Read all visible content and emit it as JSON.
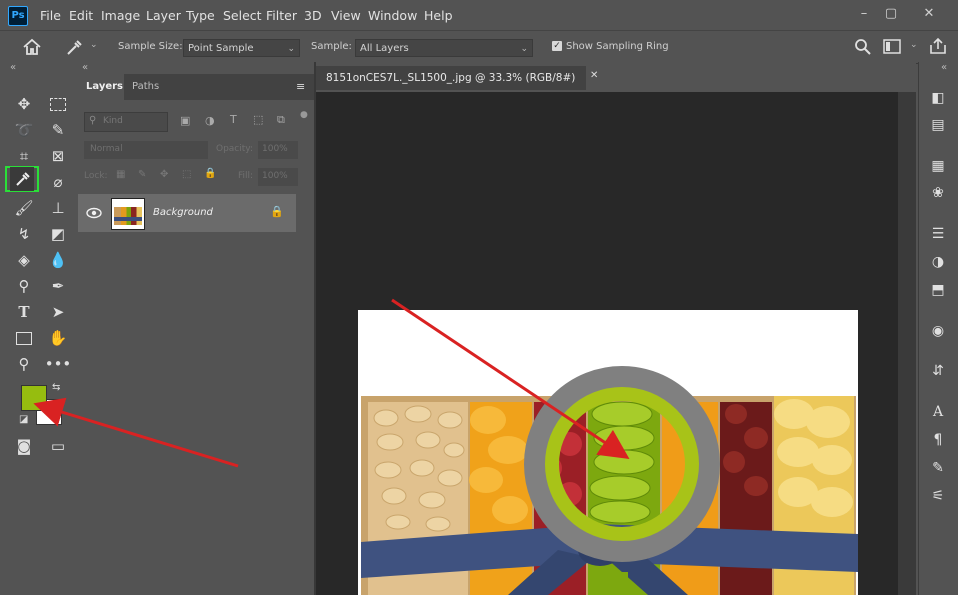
{
  "app": {
    "logo_text": "Ps",
    "menu": [
      "File",
      "Edit",
      "Image",
      "Layer",
      "Type",
      "Select",
      "Filter",
      "3D",
      "View",
      "Window",
      "Help"
    ],
    "window_controls": [
      "–",
      "▢",
      "✕"
    ]
  },
  "options_bar": {
    "sample_size_label": "Sample Size:",
    "sample_size_value": "Point Sample",
    "sample_label": "Sample:",
    "sample_value": "All Layers",
    "show_ring_label": "Show Sampling Ring",
    "show_ring_checked": true
  },
  "panel": {
    "collapse_glyph": "«",
    "tabs": [
      "Layers",
      "Paths"
    ],
    "filter_placeholder": "Kind",
    "blend_mode": "Normal",
    "opacity_label": "Opacity:",
    "opacity_value": "100%",
    "lock_label": "Lock:",
    "fill_label": "Fill:",
    "fill_value": "100%",
    "layer_name": "Background"
  },
  "document": {
    "tab_title": "8151onCES7L._SL1500_.jpg @ 33.3% (RGB/8#)"
  },
  "colors": {
    "foreground": "#96bd0f",
    "background": "#ffffff",
    "accent_box": "#2adf38",
    "arrow": "#d92222",
    "ring_outer": "#808080",
    "ring_inner": "#a8c318"
  }
}
